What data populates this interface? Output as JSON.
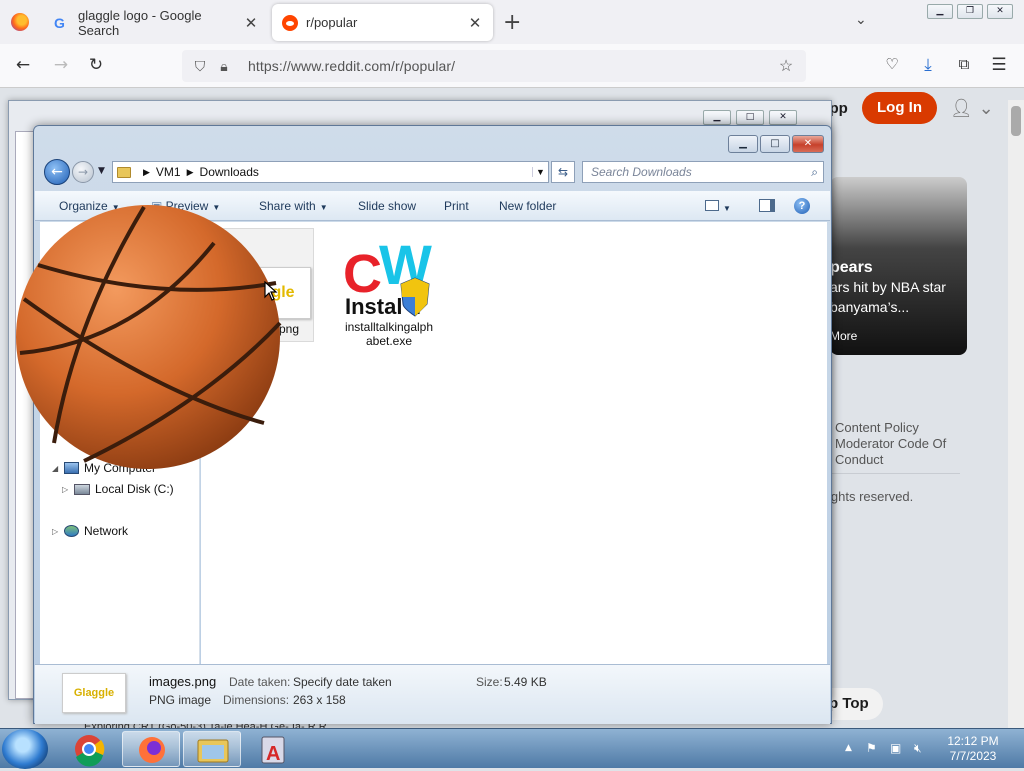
{
  "browser": {
    "tabs": [
      {
        "label": "glaggle logo - Google Search",
        "active": false
      },
      {
        "label": "r/popular",
        "active": true
      }
    ],
    "url": "https://www.reddit.com/r/popular/"
  },
  "reddit": {
    "get_app": "Get App",
    "login": "Log In",
    "card_headline": "pears",
    "card_text_1": "ars hit by NBA star",
    "card_text_2": "banyama’s...",
    "card_more": "More",
    "footer_links": [
      "Content Policy",
      "Moderator Code Of",
      "Conduct"
    ],
    "rights": "ights reserved.",
    "to_top": "p Top",
    "bottom_partial": "Exploring CRT (Go-50-3)   Ta-le Hea-H   Ge-      Ia-     R R"
  },
  "explorer": {
    "breadcrumb": [
      "VM1",
      "Downloads"
    ],
    "search_placeholder": "Search Downloads",
    "toolbar": {
      "organize": "Organize",
      "preview": "Preview",
      "share_with": "Share with",
      "slide_show": "Slide show",
      "print": "Print",
      "new_folder": "New folder"
    },
    "tree": {
      "computer": "My Computer",
      "local_disk": "Local Disk (C:)",
      "network": "Network"
    },
    "files": [
      {
        "name": "images.png",
        "display": "png",
        "thumb_text": "gle"
      },
      {
        "name": "installtalkingalphabet.exe",
        "line1": "installtalkingalph",
        "line2": "abet.exe"
      }
    ],
    "details": {
      "filename": "images.png",
      "filetype": "PNG image",
      "date_label": "Date taken:",
      "date_value": "Specify date taken",
      "dim_label": "Dimensions:",
      "dim_value": "263 x 158",
      "size_label": "Size:",
      "size_value": "5.49 KB",
      "thumb_text": "Glaggle"
    }
  },
  "taskbar": {
    "time": "12:12 PM",
    "date": "7/7/2023"
  },
  "colors": {
    "reddit_orange": "#d93a00",
    "explorer_frame": "#b9cde3",
    "taskbar": "#4f7aa6"
  }
}
